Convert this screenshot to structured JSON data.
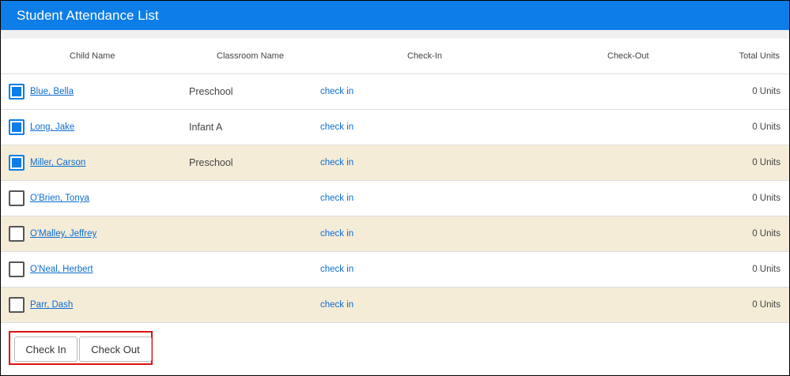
{
  "header": {
    "title": "Student Attendance List"
  },
  "columns": {
    "child_name": "Child Name",
    "classroom_name": "Classroom Name",
    "check_in": "Check-In",
    "check_out": "Check-Out",
    "total_units": "Total Units"
  },
  "rows": [
    {
      "name": "Blue, Bella",
      "classroom": "Preschool",
      "checkin": "check in",
      "units": "0 Units",
      "checked": true,
      "alt": false
    },
    {
      "name": "Long, Jake",
      "classroom": "Infant A",
      "checkin": "check in",
      "units": "0 Units",
      "checked": true,
      "alt": false
    },
    {
      "name": "Miller, Carson",
      "classroom": "Preschool",
      "checkin": "check in",
      "units": "0 Units",
      "checked": true,
      "alt": true
    },
    {
      "name": "O'Brien, Tonya",
      "classroom": "",
      "checkin": "check in",
      "units": "0 Units",
      "checked": false,
      "alt": false
    },
    {
      "name": "O'Malley, Jeffrey",
      "classroom": "",
      "checkin": "check in",
      "units": "0 Units",
      "checked": false,
      "alt": true
    },
    {
      "name": "O'Neal, Herbert",
      "classroom": "",
      "checkin": "check in",
      "units": "0 Units",
      "checked": false,
      "alt": false
    },
    {
      "name": "Parr, Dash",
      "classroom": "",
      "checkin": "check in",
      "units": "0 Units",
      "checked": false,
      "alt": true
    }
  ],
  "footer": {
    "check_in_label": "Check In",
    "check_out_label": "Check Out"
  },
  "colors": {
    "accent": "#0d7de8",
    "row_alt": "#f5ecd8",
    "highlight": "#dd1111"
  }
}
